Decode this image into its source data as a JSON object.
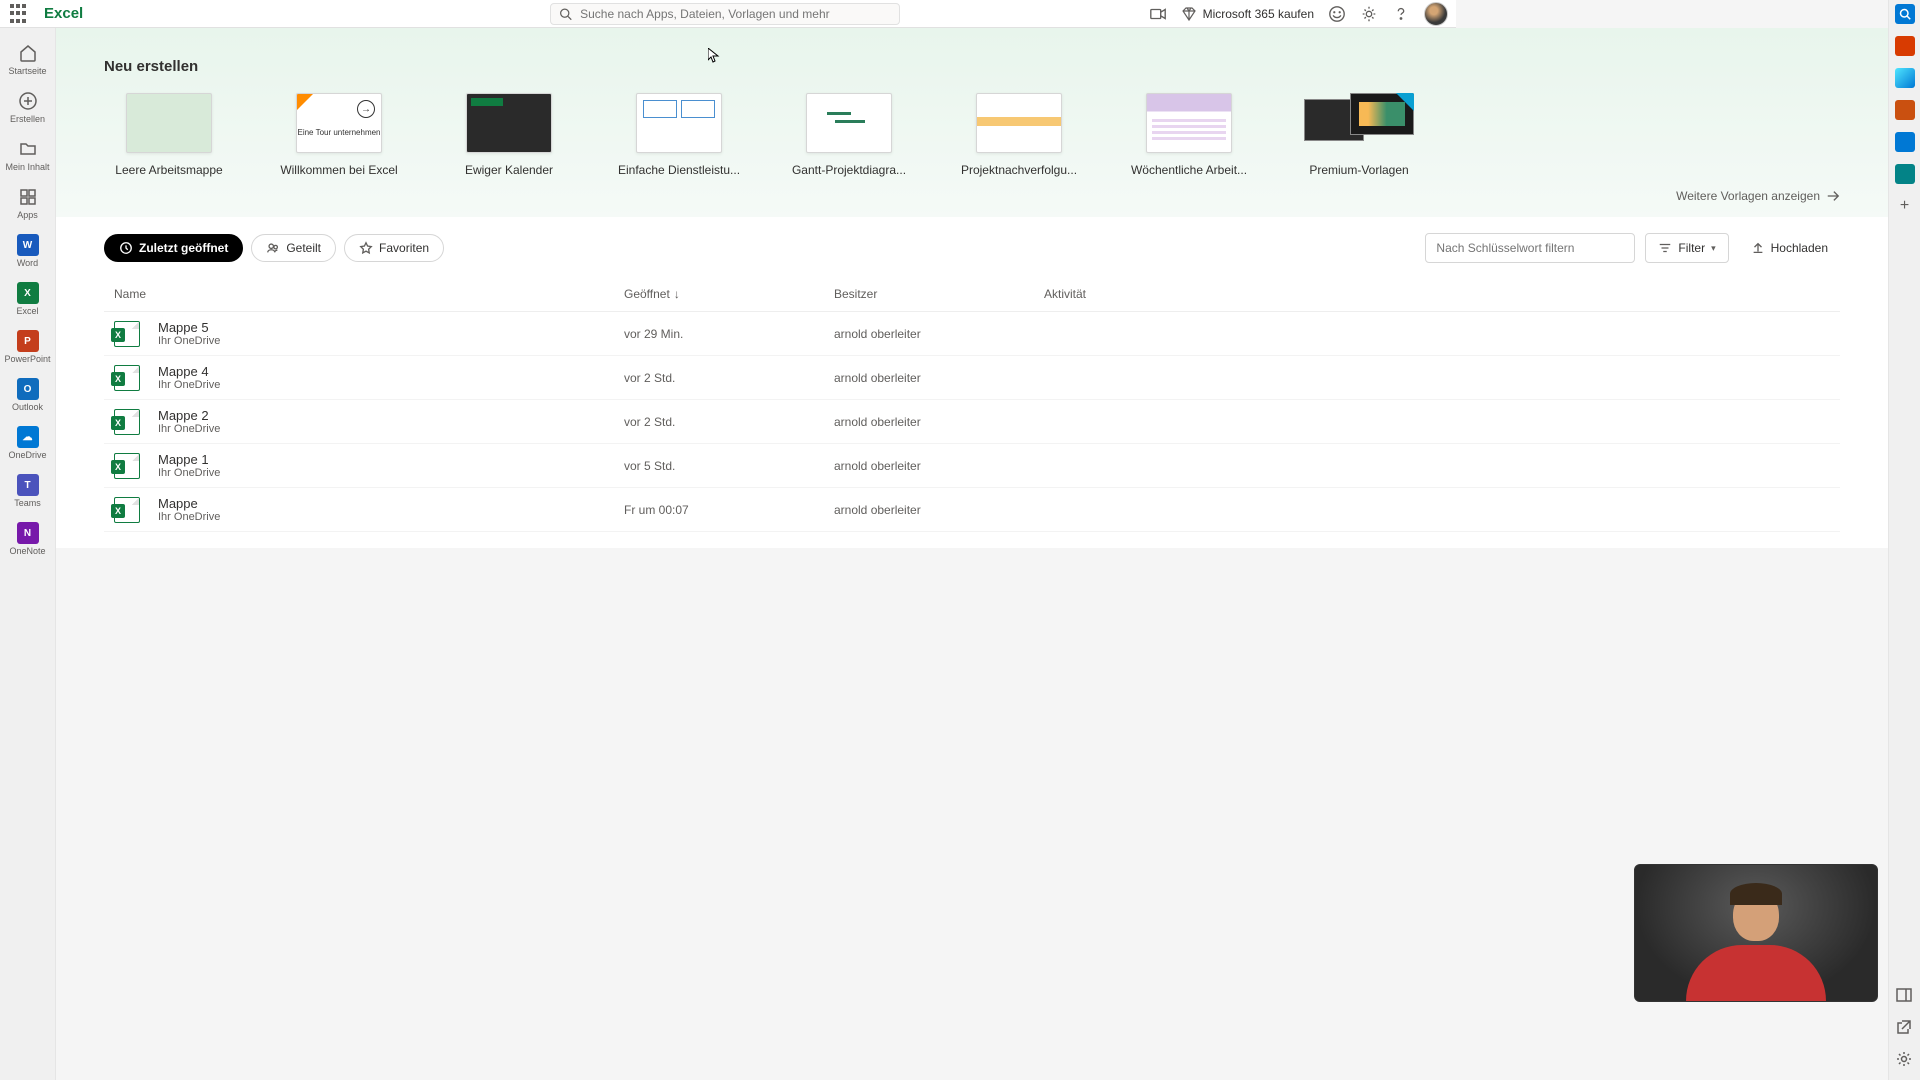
{
  "header": {
    "appTitle": "Excel",
    "searchPlaceholder": "Suche nach Apps, Dateien, Vorlagen und mehr",
    "buyLabel": "Microsoft 365 kaufen"
  },
  "leftNav": {
    "home": "Startseite",
    "create": "Erstellen",
    "myContent": "Mein Inhalt",
    "apps": "Apps",
    "word": "Word",
    "excel": "Excel",
    "powerpoint": "PowerPoint",
    "outlook": "Outlook",
    "onedrive": "OneDrive",
    "teams": "Teams",
    "onenote": "OneNote"
  },
  "hero": {
    "title": "Neu erstellen",
    "moreTemplates": "Weitere Vorlagen anzeigen",
    "templates": [
      "Leere Arbeitsmappe",
      "Willkommen bei Excel",
      "Ewiger Kalender",
      "Einfache Dienstleistu...",
      "Gantt-Projektdiagra...",
      "Projektnachverfolgu...",
      "Wöchentliche Arbeit...",
      "Premium-Vorlagen"
    ],
    "welcomeTourText": "Eine Tour unternehmen"
  },
  "files": {
    "tabs": {
      "recent": "Zuletzt geöffnet",
      "shared": "Geteilt",
      "fav": "Favoriten"
    },
    "filterPlaceholder": "Nach Schlüsselwort filtern",
    "filterBtn": "Filter",
    "uploadBtn": "Hochladen",
    "columns": {
      "name": "Name",
      "opened": "Geöffnet",
      "owner": "Besitzer",
      "activity": "Aktivität"
    },
    "location": "Ihr OneDrive",
    "rows": [
      {
        "name": "Mappe 5",
        "opened": "vor 29 Min.",
        "owner": "arnold oberleiter"
      },
      {
        "name": "Mappe 4",
        "opened": "vor 2 Std.",
        "owner": "arnold oberleiter"
      },
      {
        "name": "Mappe 2",
        "opened": "vor 2 Std.",
        "owner": "arnold oberleiter"
      },
      {
        "name": "Mappe 1",
        "opened": "vor 5 Std.",
        "owner": "arnold oberleiter"
      },
      {
        "name": "Mappe",
        "opened": "Fr um 00:07",
        "owner": "arnold oberleiter"
      }
    ]
  }
}
